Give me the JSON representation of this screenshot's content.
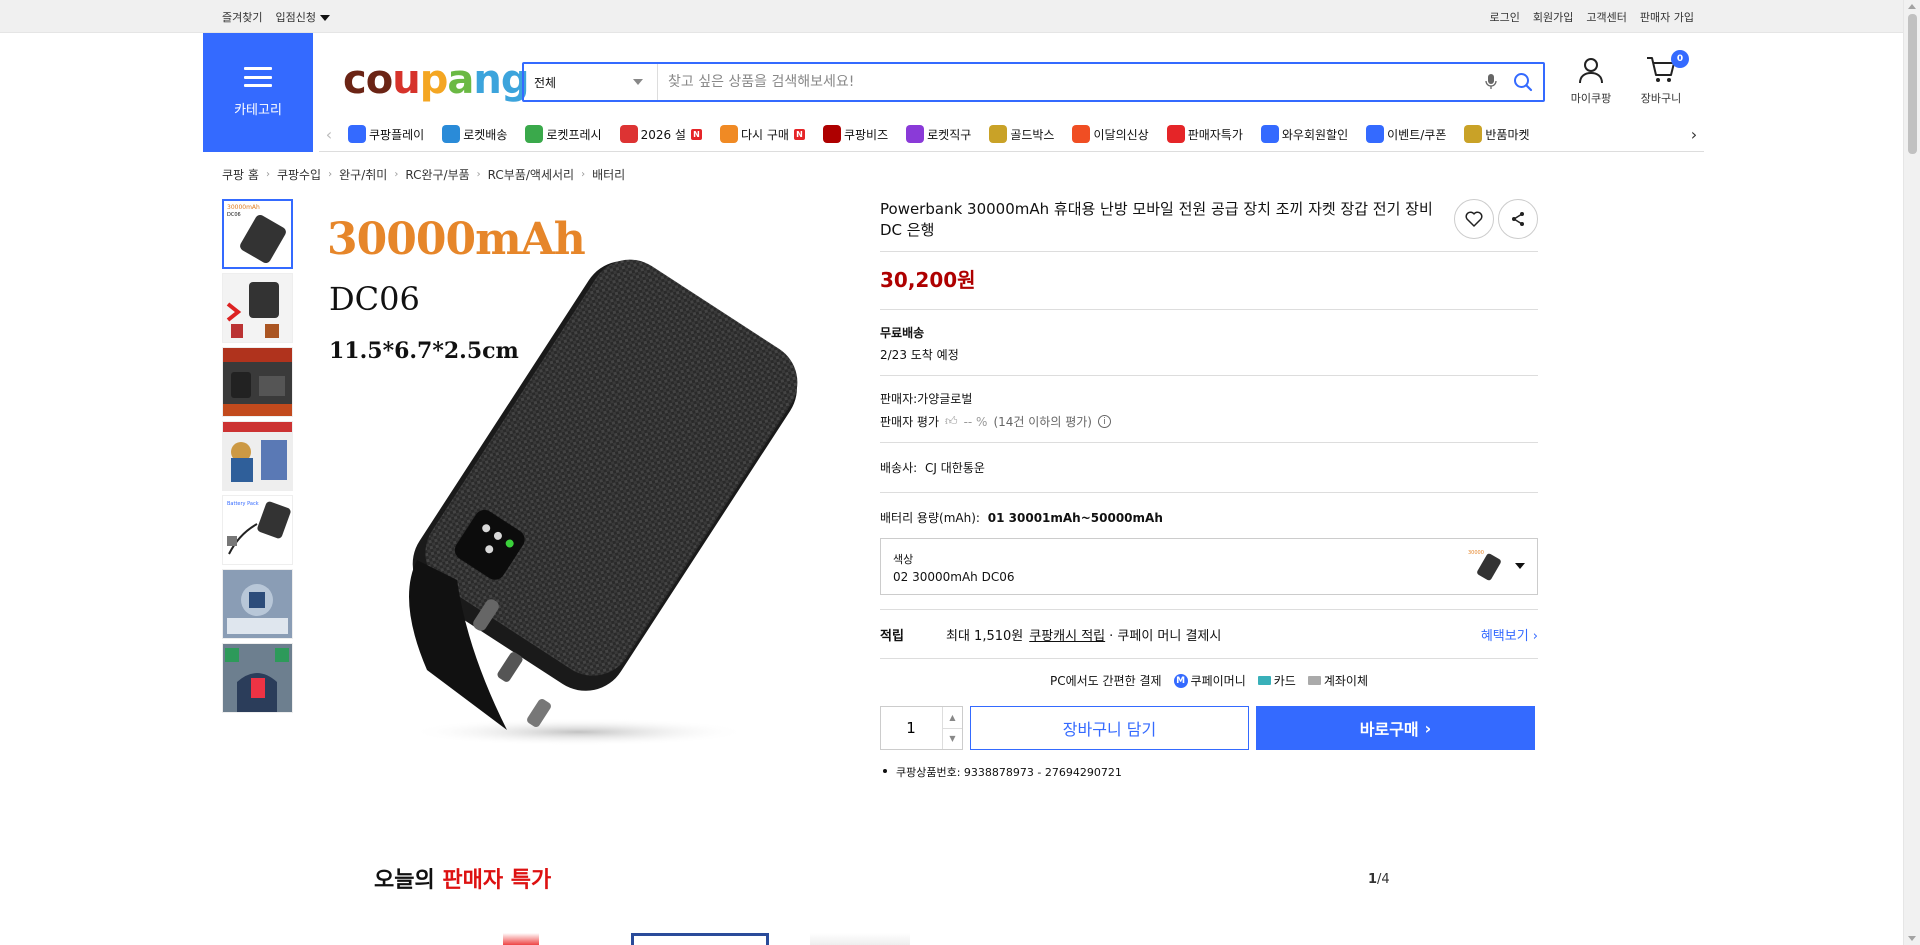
{
  "topbar": {
    "left": [
      "즐겨찾기",
      "입점신청"
    ],
    "right": [
      "로그인",
      "회원가입",
      "고객센터",
      "판매자 가입"
    ]
  },
  "header": {
    "category_label": "카테고리",
    "logo_text": "coupang",
    "search": {
      "scope": "전체",
      "placeholder": "찾고 싶은 상품을 검색해보세요!"
    },
    "mycoupang_label": "마이쿠팡",
    "cart_label": "장바구니",
    "cart_count": "0"
  },
  "catnav": [
    {
      "label": "쿠팡플레이",
      "icon": "play-icon",
      "color": "#346aff",
      "badge": ""
    },
    {
      "label": "로켓배송",
      "icon": "rocket-icon",
      "color": "#2a8bd8",
      "badge": ""
    },
    {
      "label": "로켓프레시",
      "icon": "rocket-fresh-icon",
      "color": "#3aa94b",
      "badge": ""
    },
    {
      "label": "2026 설",
      "icon": "gift-icon",
      "color": "#d33",
      "badge": "N"
    },
    {
      "label": "다시 구매",
      "icon": "home-icon",
      "color": "#f08a24",
      "badge": "N"
    },
    {
      "label": "쿠팡비즈",
      "icon": "biz-icon",
      "color": "#ae0000",
      "badge": ""
    },
    {
      "label": "로켓직구",
      "icon": "global-icon",
      "color": "#8a3ad8",
      "badge": ""
    },
    {
      "label": "골드박스",
      "icon": "goldbox-icon",
      "color": "#c9a227",
      "badge": ""
    },
    {
      "label": "이달의신상",
      "icon": "new-bag-icon",
      "color": "#f04e23",
      "badge": ""
    },
    {
      "label": "판매자특가",
      "icon": "percent-icon",
      "color": "#e52528",
      "badge": ""
    },
    {
      "label": "와우회원할인",
      "icon": "wow-icon",
      "color": "#346aff",
      "badge": ""
    },
    {
      "label": "이벤트/쿠폰",
      "icon": "coupon-icon",
      "color": "#346aff",
      "badge": ""
    },
    {
      "label": "반품마켓",
      "icon": "market-icon",
      "color": "#c9a227",
      "badge": ""
    }
  ],
  "breadcrumbs": [
    "쿠팡 홈",
    "쿠팡수입",
    "완구/취미",
    "RC완구/부품",
    "RC부품/액세서리",
    "배터리"
  ],
  "image_text": {
    "capacity": "30000mAh",
    "model": "DC06",
    "dims": "11.5*6.7*2.5cm"
  },
  "product": {
    "title": "Powerbank 30000mAh 휴대용 난방 모바일 전원 공급 장치 조끼 자켓 장갑 전기 장비 DC 은행",
    "price": "30,200원",
    "shipping_title": "무료배송",
    "arrival": "2/23 도착 예정",
    "seller": "판매자:가양글로벌",
    "seller_rating_label": "판매자 평가",
    "seller_rating_value": "-- %",
    "seller_rating_note": "(14건 이하의 평가)",
    "carrier_label": "배송사:",
    "carrier": "CJ 대한통운",
    "battery_label": "배터리 용량(mAh):",
    "battery_value": "01 30001mAh~50000mAh",
    "option_label": "색상",
    "option_value": "02 30000mAh DC06",
    "points_label": "적립",
    "points_text_1": "최대 1,510원",
    "points_link": "쿠팡캐시 적립",
    "points_text_2": "· 쿠페이 머니 결제시",
    "benefits_link": "혜택보기",
    "pay_title": "PC에서도 간편한 결제",
    "pay_methods": [
      "쿠페이머니",
      "카드",
      "계좌이체"
    ],
    "quantity": "1",
    "cart_button": "장바구니 담기",
    "buy_button": "바로구매",
    "product_no": "쿠팡상품번호: 9338878973 - 27694290721"
  },
  "deals": {
    "title_1": "오늘의",
    "title_2": "판매자 특가",
    "page_current": "1",
    "page_total": "/4"
  },
  "colors": {
    "accent": "#346aff",
    "price": "#ae0000",
    "deal_red": "#d11"
  }
}
